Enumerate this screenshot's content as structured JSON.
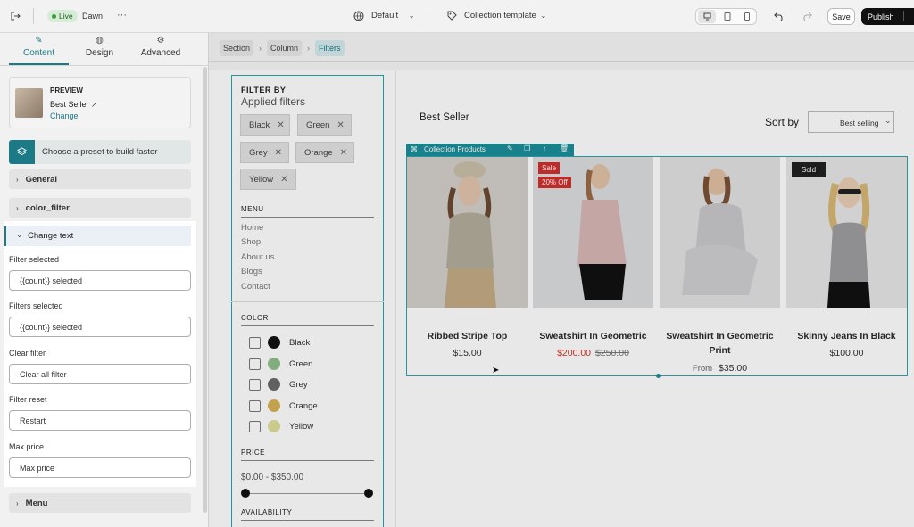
{
  "topbar": {
    "live_badge": "Live",
    "theme_name": "Dawn",
    "more": "···",
    "device": "Default",
    "template": "Collection template",
    "save": "Save",
    "publish": "Publish"
  },
  "sidebar": {
    "tabs": [
      {
        "label": "Content",
        "icon": "pencil-icon"
      },
      {
        "label": "Design",
        "icon": "palette-icon"
      },
      {
        "label": "Advanced",
        "icon": "gear-icon"
      }
    ],
    "preview": {
      "heading": "PREVIEW",
      "title": "Best Seller",
      "change": "Change"
    },
    "preset_label": "Choose a preset to build faster",
    "accordions": {
      "general": "General",
      "color_filter": "color_filter",
      "change_text": "Change text",
      "menu": "Menu"
    },
    "fields": [
      {
        "label": "Filter selected",
        "value": "{{count}} selected"
      },
      {
        "label": "Filters selected",
        "value": "{{count}} selected"
      },
      {
        "label": "Clear filter",
        "value": "Clear all filter"
      },
      {
        "label": "Filter reset",
        "value": "Restart"
      },
      {
        "label": "Max price",
        "value": "Max price"
      }
    ]
  },
  "breadcrumb": [
    "Section",
    "Column",
    "Filters"
  ],
  "filters": {
    "heading": "FILTER BY",
    "applied_label": "Applied filters",
    "chips": [
      "Black",
      "Green",
      "Grey",
      "Orange",
      "Yellow"
    ],
    "menu_heading": "MENU",
    "menu_links": [
      "Home",
      "Shop",
      "About us",
      "Blogs",
      "Contact"
    ],
    "color_heading": "COLOR",
    "colors": [
      {
        "name": "Black",
        "hex": "#111111"
      },
      {
        "name": "Green",
        "hex": "#8fbf8c"
      },
      {
        "name": "Grey",
        "hex": "#6b6b6b"
      },
      {
        "name": "Orange",
        "hex": "#d8b157"
      },
      {
        "name": "Yellow",
        "hex": "#dede9a"
      }
    ],
    "price_heading": "PRICE",
    "price_range": "$0.00 - $350.00",
    "availability_heading": "AVAILABILITY"
  },
  "collection": {
    "title": "Best Seller",
    "sort_label": "Sort by",
    "sort_value": "Best selling",
    "toolbar_label": "Collection Products",
    "products": [
      {
        "name": "Ribbed Stripe Top",
        "price": "$15.00",
        "compare": "",
        "prefix": "",
        "badges": []
      },
      {
        "name": "Sweatshirt In Geometric",
        "price": "$200.00",
        "compare": "$250.00",
        "prefix": "",
        "badges": [
          "Sale",
          "20% Off"
        ]
      },
      {
        "name": "Sweatshirt In Geometric Print",
        "price": "$35.00",
        "compare": "",
        "prefix": "From",
        "badges": []
      },
      {
        "name": "Skinny Jeans In Black",
        "price": "$100.00",
        "compare": "",
        "prefix": "",
        "badges": [
          "Sold"
        ]
      }
    ]
  },
  "colors": {
    "accent": "#1b7a86",
    "sale_red": "#d0312d",
    "sold_dark": "#222222"
  }
}
